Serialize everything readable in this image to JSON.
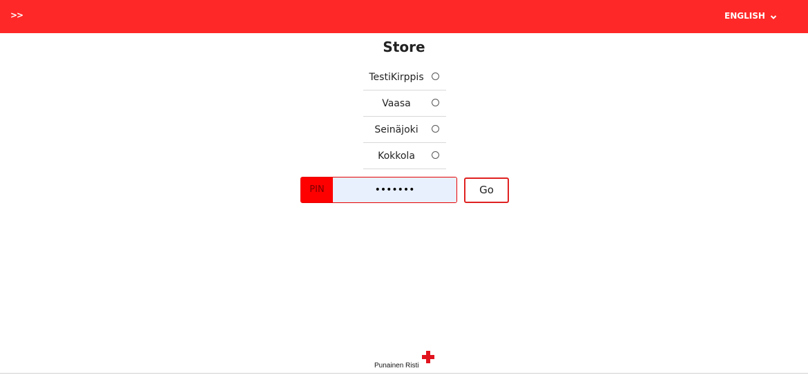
{
  "header": {
    "menu_toggle_label": ">>",
    "language_label": "ENGLISH",
    "language_icon": "chevron-down-icon",
    "bar_color": "#ff2828"
  },
  "main": {
    "title": "Store",
    "stores": [
      {
        "label": "TestiKirppis",
        "selected": false
      },
      {
        "label": "Vaasa",
        "selected": false
      },
      {
        "label": "Seinäjoki",
        "selected": false
      },
      {
        "label": "Kokkola",
        "selected": false
      }
    ],
    "pin": {
      "label": "PIN",
      "value": "•••••••",
      "type": "password"
    },
    "go_label": "Go"
  },
  "footer": {
    "logo_text": "Punainen Risti",
    "logo_icon": "red-cross-icon",
    "logo_color": "#e1141e"
  }
}
